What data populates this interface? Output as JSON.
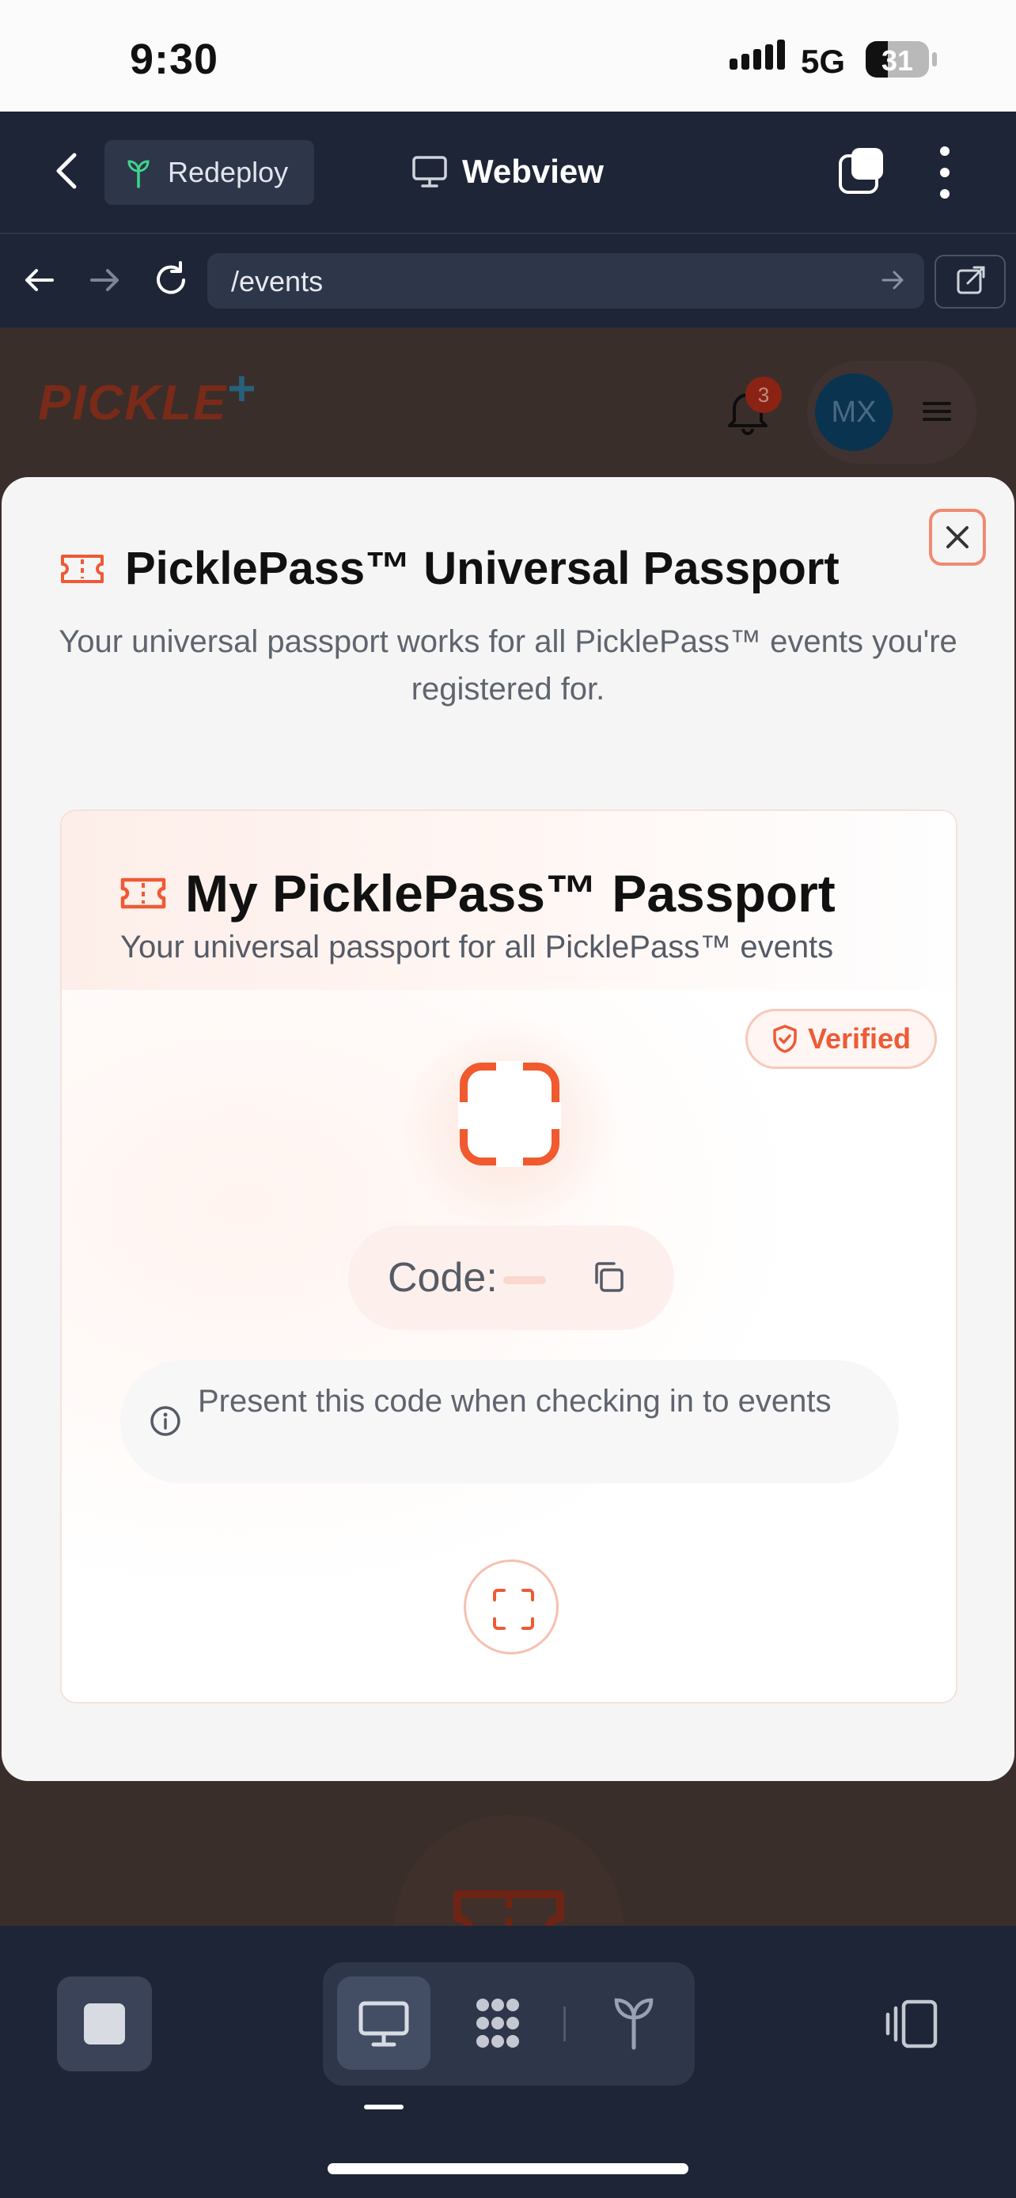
{
  "status_bar": {
    "time": "9:30",
    "network": "5G",
    "battery": "31"
  },
  "toolbar": {
    "redeploy_label": "Redeploy",
    "webview_label": "Webview"
  },
  "url_bar": {
    "url": "/events"
  },
  "background_page": {
    "logo_text": "PICKLE",
    "logo_plus": "+",
    "notification_count": "3",
    "avatar_initials": "MX"
  },
  "modal": {
    "title": "PicklePass™ Universal Passport",
    "subtitle": "Your universal passport works for all PicklePass™ events you're registered for.",
    "card": {
      "title": "My PicklePass™ Passport",
      "subtitle": "Your universal passport for all PicklePass™ events",
      "badge": "Verified",
      "code_label": "Code:",
      "info_text": "Present this code when checking in to events"
    }
  },
  "colors": {
    "accent": "#ee5a35",
    "toolbar_bg": "#1e2536",
    "modal_bg": "#f5f5f5"
  },
  "icons": [
    "chevron-left-icon",
    "sprout-icon",
    "monitor-icon",
    "tabs-icon",
    "more-vertical-icon",
    "arrow-left-icon",
    "arrow-right-icon",
    "reload-icon",
    "external-link-icon",
    "bell-icon",
    "menu-icon",
    "ticket-icon",
    "close-icon",
    "shield-check-icon",
    "copy-icon",
    "info-icon",
    "scan-icon",
    "stop-icon",
    "grid-icon",
    "device-icon"
  ]
}
